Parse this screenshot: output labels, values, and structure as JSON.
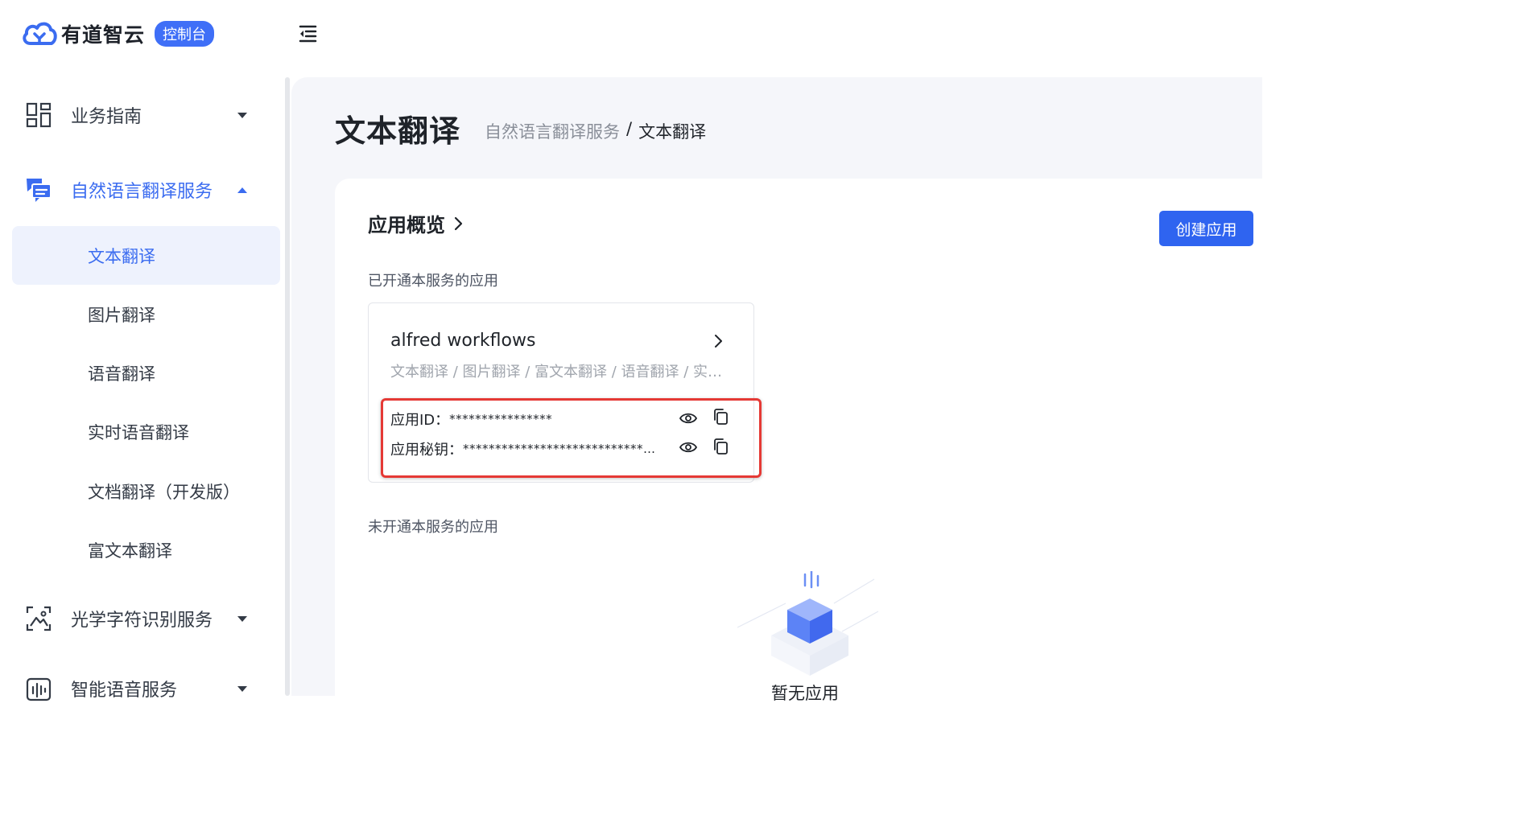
{
  "brand": {
    "name": "有道智云",
    "badge": "控制台"
  },
  "sidebar": {
    "groups": [
      {
        "label": "业务指南",
        "icon": "grid-icon",
        "expanded": false
      },
      {
        "label": "自然语言翻译服务",
        "icon": "chat-translate-icon",
        "expanded": true
      },
      {
        "label": "光学字符识别服务",
        "icon": "scan-image-icon",
        "expanded": false
      },
      {
        "label": "智能语音服务",
        "icon": "audio-wave-icon",
        "expanded": false
      }
    ],
    "subitems": [
      {
        "label": "文本翻译",
        "selected": true
      },
      {
        "label": "图片翻译",
        "selected": false
      },
      {
        "label": "语音翻译",
        "selected": false
      },
      {
        "label": "实时语音翻译",
        "selected": false
      },
      {
        "label": "文档翻译（开发版）",
        "selected": false
      },
      {
        "label": "富文本翻译",
        "selected": false
      }
    ]
  },
  "page": {
    "title": "文本翻译",
    "breadcrumb": {
      "parent": "自然语言翻译服务",
      "separator": "/",
      "current": "文本翻译"
    }
  },
  "overview": {
    "title": "应用概览",
    "create_button": "创建应用",
    "enabled_label": "已开通本服务的应用",
    "disabled_label": "未开通本服务的应用",
    "app": {
      "name": "alfred workflows",
      "services": "文本翻译 / 图片翻译 / 富文本翻译 / 语音翻译 / 实时语音翻译",
      "id_label": "应用ID：",
      "id_value": "****************",
      "secret_label": "应用秘钥：",
      "secret_value": "********************************"
    },
    "empty_text": "暂无应用"
  },
  "colors": {
    "accent": "#3b6cf0",
    "button": "#2f64f0",
    "highlight": "#e53935"
  }
}
